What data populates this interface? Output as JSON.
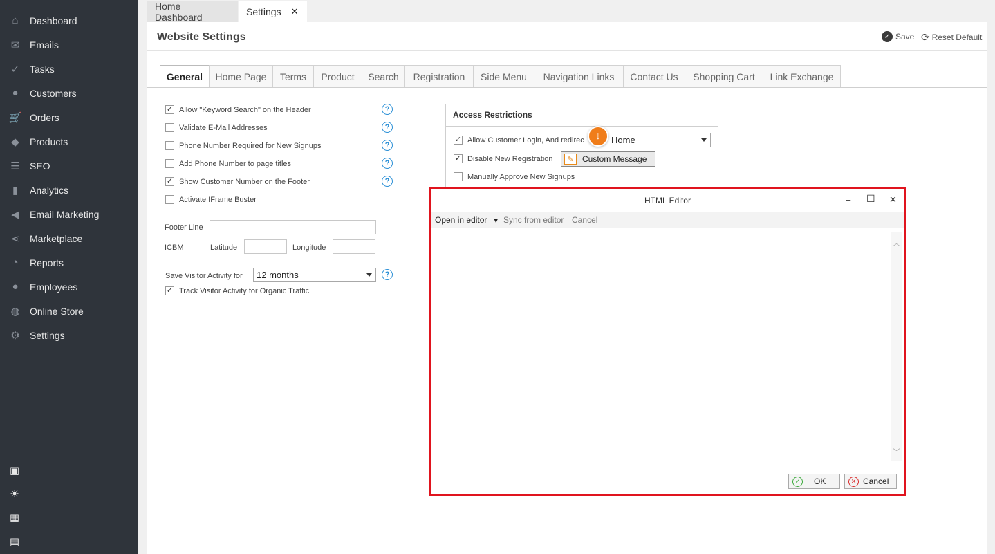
{
  "sidebar": {
    "items": [
      {
        "label": "Dashboard",
        "icon": "home-icon",
        "glyph": "⌂"
      },
      {
        "label": "Emails",
        "icon": "envelope-icon",
        "glyph": "✉"
      },
      {
        "label": "Tasks",
        "icon": "tasks-icon",
        "glyph": "✓"
      },
      {
        "label": "Customers",
        "icon": "user-icon",
        "glyph": "●"
      },
      {
        "label": "Orders",
        "icon": "cart-icon",
        "glyph": "🛒"
      },
      {
        "label": "Products",
        "icon": "tag-icon",
        "glyph": "◆"
      },
      {
        "label": "SEO",
        "icon": "sliders-icon",
        "glyph": "☰"
      },
      {
        "label": "Analytics",
        "icon": "bar-chart-icon",
        "glyph": "▮"
      },
      {
        "label": "Email Marketing",
        "icon": "megaphone-icon",
        "glyph": "◀"
      },
      {
        "label": "Marketplace",
        "icon": "share-icon",
        "glyph": "⋖"
      },
      {
        "label": "Reports",
        "icon": "pie-chart-icon",
        "glyph": "◔"
      },
      {
        "label": "Employees",
        "icon": "users-icon",
        "glyph": "●"
      },
      {
        "label": "Online Store",
        "icon": "globe-icon",
        "glyph": "◍"
      },
      {
        "label": "Settings",
        "icon": "gear-icon",
        "glyph": "⚙"
      }
    ],
    "bottom_icons": [
      {
        "icon": "windows-icon",
        "glyph": "▣"
      },
      {
        "icon": "lightbulb-icon",
        "glyph": "☀"
      },
      {
        "icon": "calculator-icon",
        "glyph": "▦"
      },
      {
        "icon": "calendar-icon",
        "glyph": "▤"
      }
    ]
  },
  "doc_tabs": {
    "home": "Home Dashboard",
    "settings": "Settings",
    "close": "✕"
  },
  "header": {
    "title": "Website Settings",
    "save": "Save",
    "reset": "Reset Default"
  },
  "settings_tabs": [
    "General",
    "Home Page",
    "Terms",
    "Product",
    "Search",
    "Registration",
    "Side Menu",
    "Navigation Links",
    "Contact Us",
    "Shopping Cart",
    "Link Exchange"
  ],
  "general": {
    "options": [
      {
        "label": "Allow \"Keyword Search\" on the Header",
        "checked": true
      },
      {
        "label": "Validate E-Mail Addresses",
        "checked": false
      },
      {
        "label": "Phone Number Required for New Signups",
        "checked": false
      },
      {
        "label": "Add Phone Number to page titles",
        "checked": false
      },
      {
        "label": "Show Customer Number on the Footer",
        "checked": true
      },
      {
        "label": "Activate IFrame Buster",
        "checked": false
      }
    ],
    "footer_line_label": "Footer Line",
    "footer_line_value": "",
    "icbm_label": "ICBM",
    "latitude_label": "Latitude",
    "longitude_label": "Longitude",
    "save_visitor_label": "Save Visitor Activity for",
    "save_visitor_value": "12 months",
    "track_visitor_label": "Track Visitor Activity for Organic Traffic",
    "track_visitor_checked": true
  },
  "access": {
    "title": "Access Restrictions",
    "allow_login_label": "Allow Customer Login, And redirec",
    "allow_login_checked": true,
    "redirect_value": "Home",
    "disable_reg_label": "Disable New Registration",
    "disable_reg_checked": true,
    "custom_message_label": "Custom Message",
    "manual_approve_label": "Manually Approve New Signups",
    "manual_approve_checked": false
  },
  "dialog": {
    "title": "HTML Editor",
    "minimize": "–",
    "maximize": "☐",
    "close": "✕",
    "open_in_editor": "Open in editor",
    "sync_from_editor": "Sync from editor",
    "cancel_link": "Cancel",
    "ok": "OK",
    "cancel": "Cancel"
  }
}
